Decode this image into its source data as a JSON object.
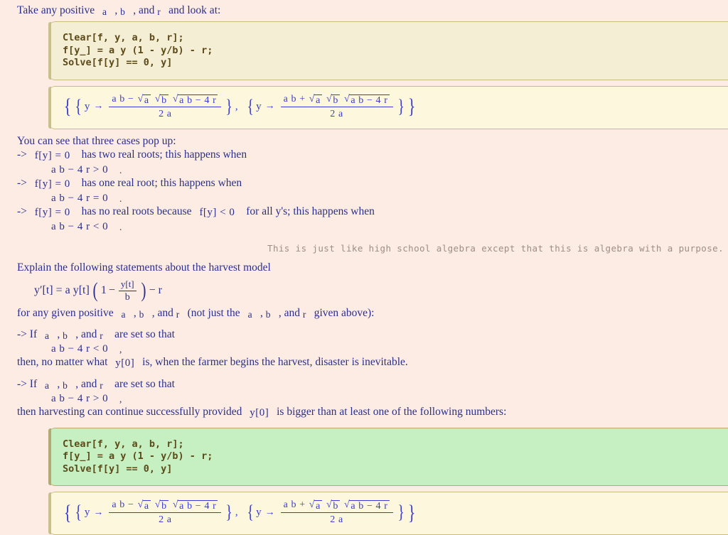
{
  "page": {
    "background": "#fcece3",
    "text_color": "#2b2f8c",
    "code_color": "#5c4a18",
    "output_color": "#3a3ad2",
    "aside_color": "#9b8f84",
    "input_cell_bg": "#f4eed4",
    "input_cell_bg_green": "#c6f0c2",
    "output_cell_bg": "#fdf8dd",
    "cell_border": "#c9bc83"
  },
  "intro": {
    "line": "Take any positive",
    "var_a": "a",
    "comma1": ",",
    "var_b": "b",
    "comma2": ", and",
    "var_r": "r",
    "tail": "and look at:"
  },
  "code_cell_1": {
    "line1": "Clear[f, y, a, b, r];",
    "line2": "f[y_] = a y (1 - y/b) - r;",
    "line3": "Solve[f[y] == 0, y]"
  },
  "output_1": {
    "open_outer": "{",
    "open_inner": "{",
    "y": "y",
    "arrow": "→",
    "num_prefix": "a b",
    "minus": "−",
    "plus": "+",
    "sqrt_a": "a",
    "sqrt_b": "b",
    "sqrt_disc": "a b − 4 r",
    "denominator": "2 a",
    "close_inner": "}",
    "comma": ",",
    "close_outer": "}"
  },
  "cases": {
    "heading": "You can see that three cases pop up:",
    "items": [
      {
        "arrow": "->",
        "eq": "f[y] = 0",
        "text": "has two real roots; this happens when",
        "condition": "a b − 4 r > 0",
        "period": "."
      },
      {
        "arrow": "->",
        "eq": "f[y] = 0",
        "text": "has one real root; this happens when",
        "condition": "a b − 4 r = 0",
        "period": "."
      },
      {
        "arrow": "->",
        "eq": "f[y] = 0",
        "text_a": "has no real roots because",
        "eq2": "f[y] < 0",
        "text_b": "for all y's; this happens when",
        "condition": "a b − 4 r < 0",
        "period": "."
      }
    ]
  },
  "aside": {
    "text": "This is just like high school algebra except that this is algebra with a purpose."
  },
  "explain": {
    "heading": "Explain the following statements about the harvest model",
    "equation": {
      "lhs": "y′[t] = a y[t]",
      "open_paren": "(",
      "one": "1",
      "minus": "−",
      "frac_num": "y[t]",
      "frac_den": "b",
      "close_paren": ")",
      "tail": "− r"
    },
    "qualifier_pre": "for any given positive",
    "var_a": "a",
    "comma1": ",",
    "var_b": "b",
    "comma2": ", and",
    "var_r": "r",
    "qualifier_mid": "(not just the",
    "var_a2": "a",
    "comma3": ",",
    "var_b2": "b",
    "comma4": ", and",
    "var_r2": "r",
    "qualifier_end": "given above):"
  },
  "statements": [
    {
      "arrow": "->",
      "lead": "If",
      "var_a": "a",
      "comma1": ",",
      "var_b": "b",
      "comma2": ", and",
      "var_r": "r",
      "tail": "are set so that",
      "condition": "a b − 4 r < 0",
      "condition_punct": ",",
      "conclusion_pre": "then, no matter what",
      "conclusion_math": "y[0]",
      "conclusion_post": "is, when the farmer begins the harvest, disaster is inevitable."
    },
    {
      "arrow": "->",
      "lead": "If",
      "var_a": "a",
      "comma1": ",",
      "var_b": "b",
      "comma2": ", and",
      "var_r": "r",
      "tail": "are set so that",
      "condition": "a b − 4 r > 0",
      "condition_punct": ",",
      "conclusion_pre": "then harvesting can continue successfully provided",
      "conclusion_math": "y[0]",
      "conclusion_post": "is bigger than at least one of the following numbers:"
    }
  ],
  "code_cell_2": {
    "line1": "Clear[f, y, a, b, r];",
    "line2": "f[y_] = a y (1 - y/b) - r;",
    "line3": "Solve[f[y] == 0, y]"
  },
  "output_2": {
    "open_outer": "{",
    "open_inner": "{",
    "y": "y",
    "arrow": "→",
    "num_prefix": "a b",
    "minus": "−",
    "plus": "+",
    "sqrt_a": "a",
    "sqrt_b": "b",
    "sqrt_disc": "a b − 4 r",
    "denominator": "2 a",
    "close_inner": "}",
    "comma": ",",
    "close_outer": "}"
  }
}
